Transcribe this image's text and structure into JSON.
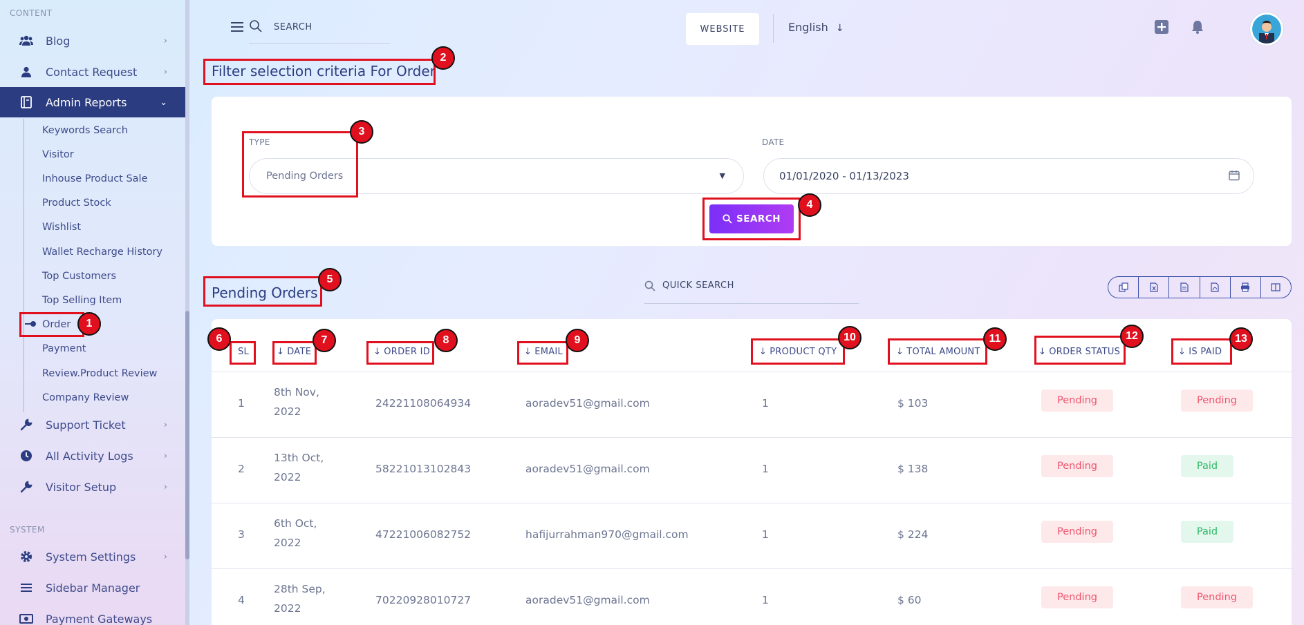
{
  "sidebar": {
    "section_content": "CONTENT",
    "section_system": "SYSTEM",
    "items_top": [
      {
        "label": "Blog",
        "icon": "users-icon"
      },
      {
        "label": "Contact Request",
        "icon": "user-icon"
      },
      {
        "label": "Admin Reports",
        "icon": "report-icon"
      }
    ],
    "sub_items": [
      "Keywords Search",
      "Visitor",
      "Inhouse Product Sale",
      "Product Stock",
      "Wishlist",
      "Wallet Recharge History",
      "Top Customers",
      "Top Selling Item",
      "Order",
      "Payment",
      "Review.Product Review",
      "Company Review"
    ],
    "items_bottom": [
      {
        "label": "Support Ticket",
        "icon": "wrench-icon"
      },
      {
        "label": "All Activity Logs",
        "icon": "clock-icon"
      },
      {
        "label": "Visitor Setup",
        "icon": "wrench-icon"
      }
    ],
    "items_system": [
      {
        "label": "System Settings",
        "icon": "gear-icon"
      },
      {
        "label": "Sidebar Manager",
        "icon": "menu-icon"
      },
      {
        "label": "Payment Gateways",
        "icon": "money-icon"
      }
    ]
  },
  "topbar": {
    "search_label": "SEARCH",
    "website_label": "WEBSITE",
    "language": "English"
  },
  "filter": {
    "heading": "Filter selection criteria For Order",
    "type_label": "TYPE",
    "type_value": "Pending Orders",
    "date_label": "DATE",
    "date_value": "01/01/2020 - 01/13/2023",
    "search_button": "SEARCH"
  },
  "orders": {
    "heading": "Pending Orders",
    "quick_search": "QUICK SEARCH",
    "columns": [
      "SL",
      "DATE",
      "ORDER ID",
      "EMAIL",
      "PRODUCT QTY",
      "TOTAL AMOUNT",
      "ORDER STATUS",
      "IS PAID"
    ],
    "rows": [
      {
        "sl": "1",
        "date_a": "8th Nov,",
        "date_b": "2022",
        "order_id": "24221108064934",
        "email": "aoradev51@gmail.com",
        "qty": "1",
        "amount": "$ 103",
        "status": "Pending",
        "paid": "Pending"
      },
      {
        "sl": "2",
        "date_a": "13th Oct,",
        "date_b": "2022",
        "order_id": "58221013102843",
        "email": "aoradev51@gmail.com",
        "qty": "1",
        "amount": "$ 138",
        "status": "Pending",
        "paid": "Paid"
      },
      {
        "sl": "3",
        "date_a": "6th Oct,",
        "date_b": "2022",
        "order_id": "47221006082752",
        "email": "hafijurrahman970@gmail.com",
        "qty": "1",
        "amount": "$ 224",
        "status": "Pending",
        "paid": "Paid"
      },
      {
        "sl": "4",
        "date_a": "28th Sep,",
        "date_b": "2022",
        "order_id": "70220928010727",
        "email": "aoradev51@gmail.com",
        "qty": "1",
        "amount": "$ 60",
        "status": "Pending",
        "paid": "Pending"
      }
    ]
  },
  "annotations": [
    "1",
    "2",
    "3",
    "4",
    "5",
    "6",
    "7",
    "8",
    "9",
    "10",
    "11",
    "12",
    "13"
  ],
  "colors": {
    "nav_active": "#2b3c80",
    "accent_gradient_start": "#7b2ff7",
    "accent_gradient_end": "#b03cf3",
    "annotation_red": "#e0101e",
    "pending_text": "#f0556d",
    "paid_text": "#2fb868"
  }
}
